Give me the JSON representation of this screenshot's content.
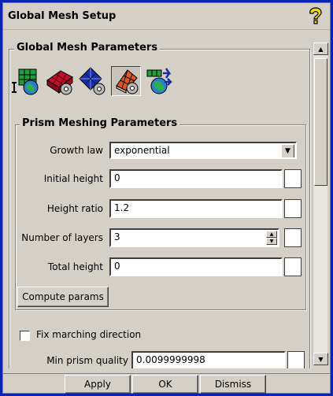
{
  "window": {
    "title": "Global Mesh Setup"
  },
  "section": {
    "title": "Global Mesh Parameters"
  },
  "icons": [
    "global-mesh-size-icon",
    "shell-meshing-icon",
    "volume-meshing-icon",
    "prism-meshing-icon",
    "periodicity-icon"
  ],
  "prism": {
    "title": "Prism Meshing Parameters",
    "growth_law": {
      "label": "Growth law",
      "value": "exponential"
    },
    "initial_height": {
      "label": "Initial height",
      "value": "0"
    },
    "height_ratio": {
      "label": "Height ratio",
      "value": "1.2"
    },
    "num_layers": {
      "label": "Number of layers",
      "value": "3"
    },
    "total_height": {
      "label": "Total height",
      "value": "0"
    },
    "compute_label": "Compute params",
    "fix_marching_label": "Fix marching direction",
    "min_quality": {
      "label": "Min prism quality",
      "value": "0.0099999998"
    }
  },
  "footer": {
    "apply": "Apply",
    "ok": "OK",
    "dismiss": "Dismiss"
  },
  "colors": {
    "frame": "#0a24b0",
    "panel": "#d4d0c8"
  }
}
